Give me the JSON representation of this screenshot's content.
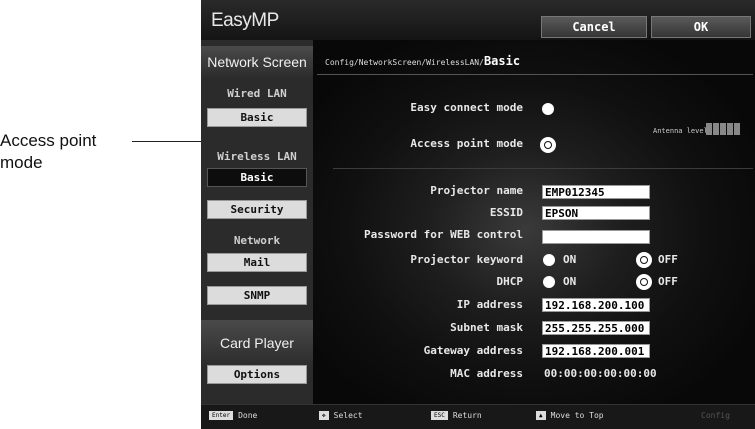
{
  "callout": {
    "line1": "Access point",
    "line2": "mode"
  },
  "topbar": {
    "logo": "EasyMP",
    "cancel_label": "Cancel",
    "ok_label": "OK"
  },
  "sidebar": {
    "network_screen": "Network Screen",
    "wired_lan": "Wired LAN",
    "wired_basic": "Basic",
    "wireless_lan": "Wireless LAN",
    "wireless_basic": "Basic",
    "security": "Security",
    "network": "Network",
    "mail": "Mail",
    "snmp": "SNMP",
    "card_player": "Card Player",
    "options": "Options"
  },
  "breadcrumb": {
    "path": "Config/NetworkScreen/WirelessLAN/",
    "current": "Basic"
  },
  "connection": {
    "easy_connect_label": "Easy connect mode",
    "access_point_label": "Access point mode",
    "selected_mode": "Access point mode",
    "antenna_label": "Antenna level"
  },
  "settings": {
    "projector_name_label": "Projector name",
    "projector_name_value": "EMP012345",
    "essid_label": "ESSID",
    "essid_value": "EPSON",
    "password_label": "Password for WEB control",
    "password_value": "",
    "keyword_label": "Projector keyword",
    "keyword_on": "ON",
    "keyword_off": "OFF",
    "keyword_selected": "OFF",
    "dhcp_label": "DHCP",
    "dhcp_on": "ON",
    "dhcp_off": "OFF",
    "dhcp_selected": "OFF",
    "ip_label": "IP address",
    "ip_value": "192.168.200.100",
    "subnet_label": "Subnet mask",
    "subnet_value": "255.255.255.000",
    "gateway_label": "Gateway address",
    "gateway_value": "192.168.200.001",
    "mac_label": "MAC address",
    "mac_value": "00:00:00:00:00:00"
  },
  "bottombar": {
    "enter_key": "Enter",
    "done": "Done",
    "select": "Select",
    "esc_key": "ESC",
    "return": "Return",
    "move_to_top": "Move to Top",
    "config": "Config"
  }
}
